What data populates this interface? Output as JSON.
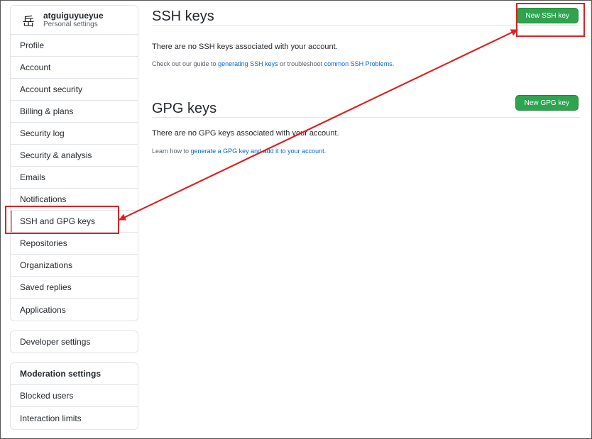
{
  "user": {
    "avatar_glyph": "岳",
    "name": "atguiguyueyue",
    "subtitle": "Personal settings"
  },
  "sidebar": {
    "items": [
      {
        "label": "Profile"
      },
      {
        "label": "Account"
      },
      {
        "label": "Account security"
      },
      {
        "label": "Billing & plans"
      },
      {
        "label": "Security log"
      },
      {
        "label": "Security & analysis"
      },
      {
        "label": "Emails"
      },
      {
        "label": "Notifications"
      },
      {
        "label": "SSH and GPG keys",
        "selected": true
      },
      {
        "label": "Repositories"
      },
      {
        "label": "Organizations"
      },
      {
        "label": "Saved replies"
      },
      {
        "label": "Applications"
      }
    ]
  },
  "developer": {
    "label": "Developer settings"
  },
  "moderation": {
    "title": "Moderation settings",
    "items": [
      {
        "label": "Blocked users"
      },
      {
        "label": "Interaction limits"
      }
    ]
  },
  "ssh": {
    "title": "SSH keys",
    "button": "New SSH key",
    "message": "There are no SSH keys associated with your account.",
    "hint_pre": "Check out our guide to ",
    "hint_link1": "generating SSH keys",
    "hint_mid": " or troubleshoot ",
    "hint_link2": "common SSH Problems",
    "hint_post": "."
  },
  "gpg": {
    "title": "GPG keys",
    "button": "New GPG key",
    "message": "There are no GPG keys associated with your account.",
    "hint_pre": "Learn how to ",
    "hint_link": "generate a GPG key and add it to your account",
    "hint_post": "."
  },
  "colors": {
    "accent_green": "#2ea44f",
    "annotation_red": "#e02020",
    "link_blue": "#0366d6",
    "selected_marker": "#f9826c"
  }
}
